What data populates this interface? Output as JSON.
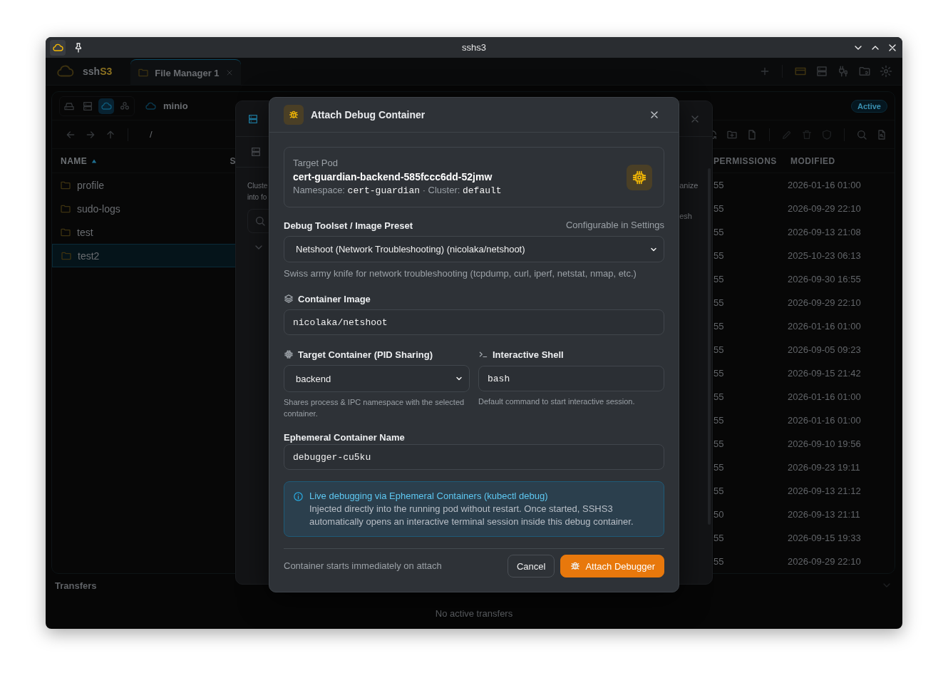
{
  "window": {
    "title": "sshs3"
  },
  "app_header": {
    "logo": {
      "text": "ssh",
      "accent": "S3"
    },
    "tabs": [
      {
        "label": "File Manager 1",
        "selected": true
      }
    ]
  },
  "file_panel": {
    "connection": "minio",
    "status_badge": "Active",
    "path": "/",
    "columns": [
      {
        "label": "NAME",
        "sorted": true
      },
      {
        "label": "S",
        "sorted": false
      },
      {
        "label": "PERMISSIONS",
        "sorted": false
      },
      {
        "label": "MODIFIED",
        "sorted": false
      }
    ],
    "folders": [
      {
        "name": "profile",
        "selected": false
      },
      {
        "name": "sudo-logs",
        "selected": false
      },
      {
        "name": "test",
        "selected": false
      },
      {
        "name": "test2",
        "selected": true
      }
    ],
    "rows": [
      {
        "permissions": "55",
        "modified": "2026-01-16 01:00"
      },
      {
        "permissions": "55",
        "modified": "2026-09-29 22:10"
      },
      {
        "permissions": "55",
        "modified": "2026-09-13 21:08"
      },
      {
        "permissions": "55",
        "modified": "2025-10-23 06:13"
      },
      {
        "permissions": "55",
        "modified": "2026-09-30 16:55"
      },
      {
        "permissions": "55",
        "modified": "2026-09-29 22:10"
      },
      {
        "permissions": "55",
        "modified": "2026-01-16 01:00"
      },
      {
        "permissions": "55",
        "modified": "2026-09-05 09:23"
      },
      {
        "permissions": "55",
        "modified": "2026-09-15 21:42"
      },
      {
        "permissions": "55",
        "modified": "2026-01-16 01:00"
      },
      {
        "permissions": "55",
        "modified": "2026-01-16 01:00"
      },
      {
        "permissions": "55",
        "modified": "2026-09-10 19:56"
      },
      {
        "permissions": "55",
        "modified": "2026-09-23 19:11"
      },
      {
        "permissions": "55",
        "modified": "2026-09-13 21:12"
      },
      {
        "permissions": "50",
        "modified": "2026-09-13 21:11"
      },
      {
        "permissions": "55",
        "modified": "2026-09-15 19:33"
      },
      {
        "permissions": "55",
        "modified": "2026-09-29 22:10"
      }
    ]
  },
  "background_dialog": {
    "description_lines": [
      "Cluste",
      "into fo"
    ],
    "right_fragments": [
      "anize",
      "esh"
    ]
  },
  "transfers": {
    "title": "Transfers",
    "empty_text": "No active transfers"
  },
  "dialog": {
    "title": "Attach Debug Container",
    "target_pod": {
      "label": "Target Pod",
      "name": "cert-guardian-backend-585fccc6dd-52jmw",
      "namespace_label": "Namespace:",
      "namespace": "cert-guardian",
      "separator": "·",
      "cluster_label": "Cluster:",
      "cluster": "default"
    },
    "preset": {
      "label": "Debug Toolset / Image Preset",
      "hint": "Configurable in Settings",
      "value": "Netshoot (Network Troubleshooting) (nicolaka/netshoot)",
      "description": "Swiss army knife for network troubleshooting (tcpdump, curl, iperf, netstat, nmap, etc.)"
    },
    "image": {
      "label": "Container Image",
      "value": "nicolaka/netshoot"
    },
    "target_container": {
      "label": "Target Container (PID Sharing)",
      "value": "backend",
      "help": "Shares process & IPC namespace with the selected container."
    },
    "shell": {
      "label": "Interactive Shell",
      "value": "bash",
      "help": "Default command to start interactive session."
    },
    "container_name": {
      "label": "Ephemeral Container Name",
      "value": "debugger-cu5ku"
    },
    "info": {
      "title": "Live debugging via Ephemeral Containers (kubectl debug)",
      "body": "Injected directly into the running pod without restart. Once started, SSHS3 automatically opens an interactive terminal session inside this debug container."
    },
    "footer_note": "Container starts immediately on attach",
    "buttons": [
      {
        "kind": "secondary",
        "label": "Cancel"
      },
      {
        "kind": "primary",
        "label": "Attach Debugger"
      }
    ]
  }
}
